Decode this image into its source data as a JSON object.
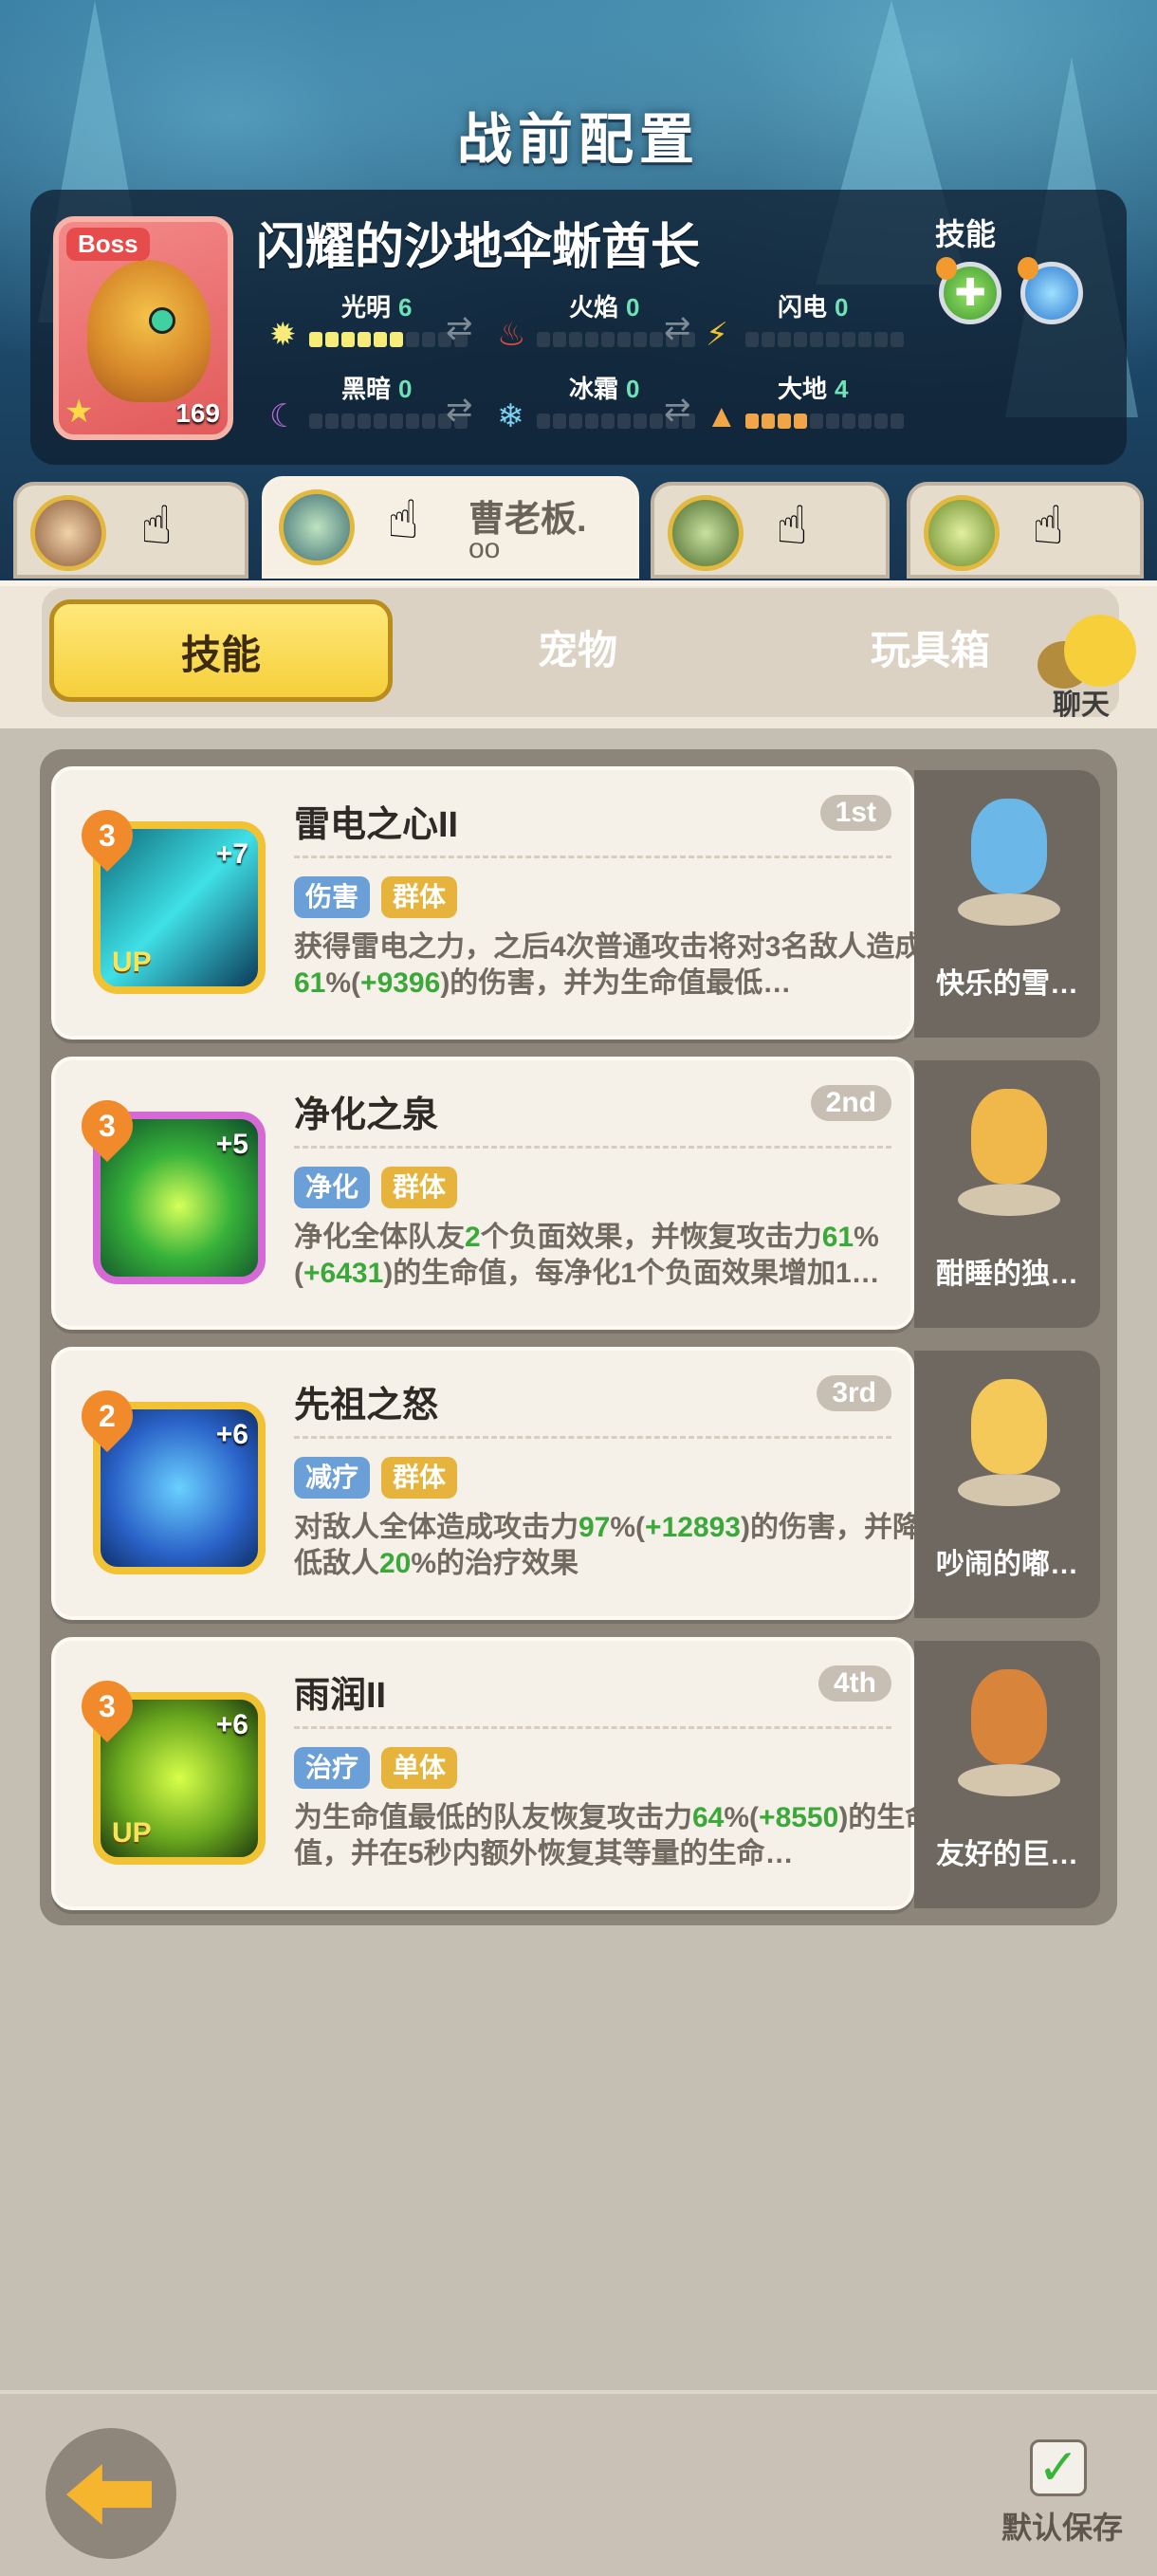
{
  "header": {
    "title": "战前配置"
  },
  "boss": {
    "tag": "Boss",
    "name": "闪耀的沙地伞蜥酋长",
    "level": "169",
    "skills_label": "技能",
    "elements": [
      {
        "name": "光明",
        "value": "6",
        "icon": "sun-icon",
        "filled": 6,
        "color": "#f7ec7a"
      },
      {
        "name": "火焰",
        "value": "0",
        "icon": "fire-icon",
        "filled": 0,
        "color": "#e54b3c"
      },
      {
        "name": "闪电",
        "value": "0",
        "icon": "lightning-icon",
        "filled": 0,
        "color": "#f2c230"
      },
      {
        "name": "黑暗",
        "value": "0",
        "icon": "moon-icon",
        "filled": 0,
        "color": "#b66ad8"
      },
      {
        "name": "冰霜",
        "value": "0",
        "icon": "snowflake-icon",
        "filled": 0,
        "color": "#7ad4f2"
      },
      {
        "name": "大地",
        "value": "4",
        "icon": "mountain-icon",
        "filled": 4,
        "color": "#f0a548"
      }
    ]
  },
  "teammates": [
    {
      "name": "",
      "active": false
    },
    {
      "name": "曹老板.",
      "dots": "oo",
      "active": true
    },
    {
      "name": "",
      "active": false
    },
    {
      "name": "",
      "active": false
    }
  ],
  "tabs": {
    "skills": "技能",
    "pets": "宠物",
    "toybox": "玩具箱",
    "active": "skills"
  },
  "chat": {
    "label": "聊天"
  },
  "skills": [
    {
      "title": "雷电之心II",
      "rank": "1st",
      "level": "3",
      "plus": "+7",
      "up": "UP",
      "tags": [
        "伤害",
        "群体"
      ],
      "desc_parts": [
        "获得雷电之力，之后4次普通攻击将对3名敌人造成",
        "61",
        "%(",
        "+9396",
        ")的伤害，并为生命值最低…"
      ],
      "pet": "快乐的雪…"
    },
    {
      "title": "净化之泉",
      "rank": "2nd",
      "level": "3",
      "plus": "+5",
      "up": "",
      "tags": [
        "净化",
        "群体"
      ],
      "desc_parts": [
        "净化全体队友",
        "2",
        "个负面效果，并恢复攻击力",
        "61",
        "%(",
        "+6431",
        ")的生命值，每净化1个负面效果增加1…"
      ],
      "pet": "酣睡的独…"
    },
    {
      "title": "先祖之怒",
      "rank": "3rd",
      "level": "2",
      "plus": "+6",
      "up": "",
      "tags": [
        "减疗",
        "群体"
      ],
      "desc_parts": [
        "对敌人全体造成攻击力",
        "97",
        "%(",
        "+12893",
        ")的伤害，并降低敌人",
        "20",
        "%的治疗效果"
      ],
      "pet": "吵闹的嘟…"
    },
    {
      "title": "雨润II",
      "rank": "4th",
      "level": "3",
      "plus": "+6",
      "up": "UP",
      "tags": [
        "治疗",
        "单体"
      ],
      "desc_parts": [
        "为生命值最低的队友恢复攻击力",
        "64",
        "%(",
        "+8550",
        ")的生命值，并在5秒内额外恢复其等量的生命…"
      ],
      "pet": "友好的巨…"
    }
  ],
  "footer": {
    "save_label": "默认保存",
    "save_checked": true,
    "check_glyph": "✓",
    "back_icon": "back-arrow-icon"
  }
}
